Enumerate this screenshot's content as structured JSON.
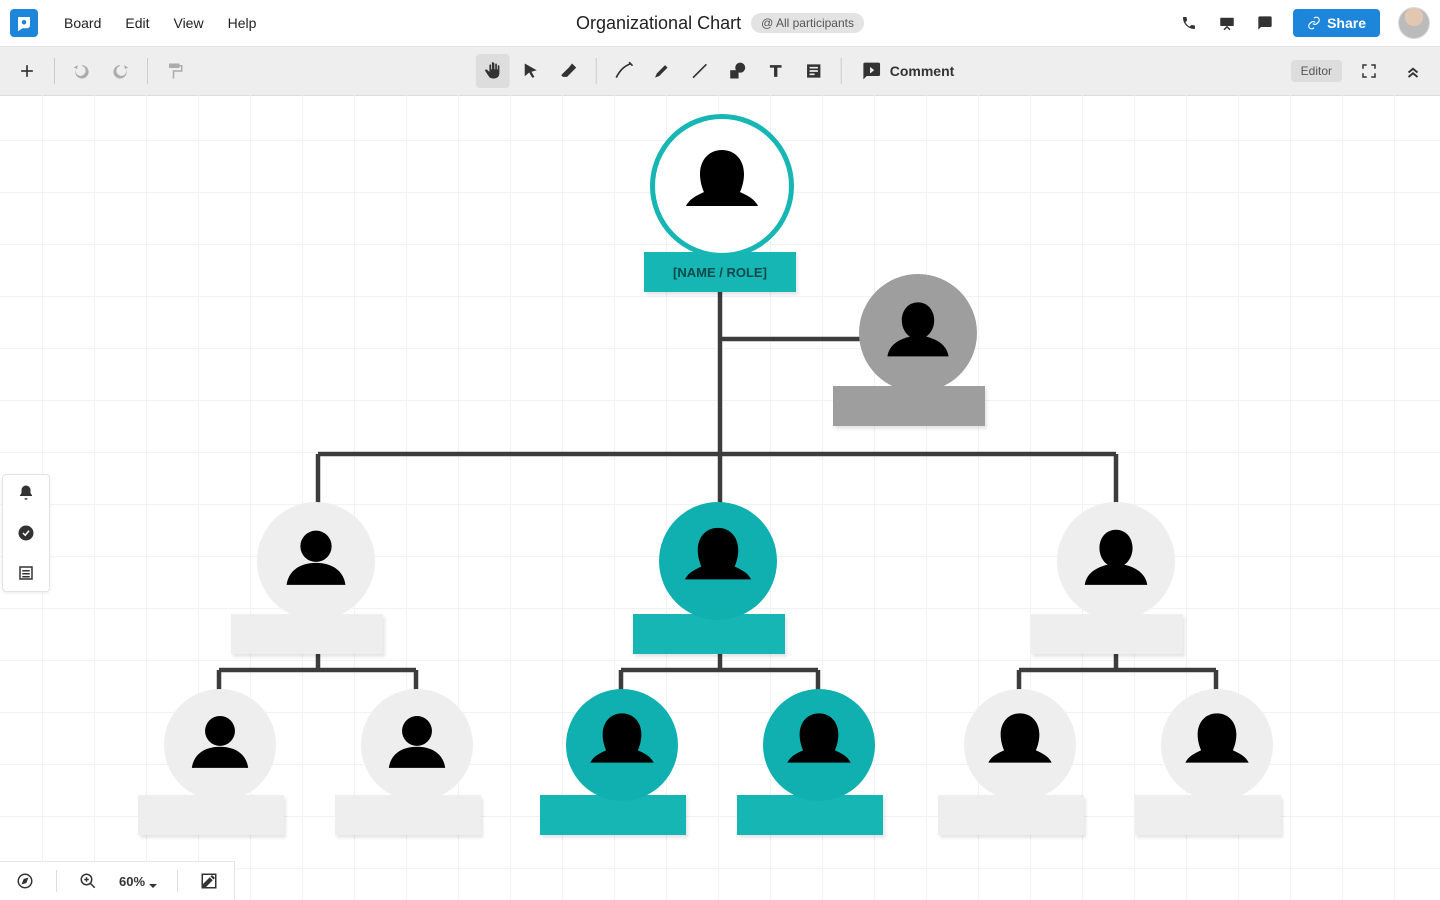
{
  "header": {
    "menus": [
      "Board",
      "Edit",
      "View",
      "Help"
    ],
    "title": "Organizational Chart",
    "participants_label": "@ All participants",
    "share_label": "Share",
    "role_label": "Editor"
  },
  "toolbar": {
    "comment_label": "Comment"
  },
  "footer": {
    "zoom_level": "60%"
  },
  "org": {
    "root_label": "[NAME / ROLE]"
  }
}
